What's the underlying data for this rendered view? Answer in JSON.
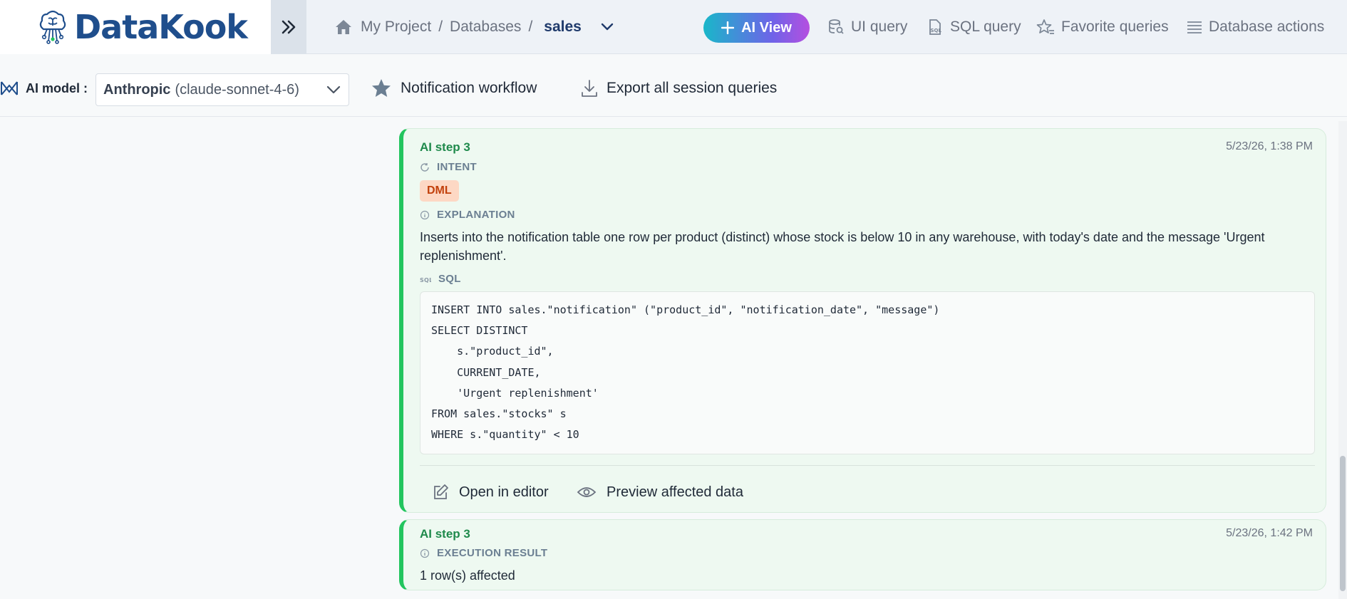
{
  "app": {
    "name": "DataKook"
  },
  "breadcrumb": {
    "project": "My Project",
    "databases": "Databases",
    "separator": "/",
    "current": "sales"
  },
  "header": {
    "ai_view": "AI View",
    "links": [
      "UI query",
      "SQL query",
      "Favorite queries",
      "Database actions"
    ]
  },
  "toolbar": {
    "model_label": "AI model :",
    "model_provider": "Anthropic",
    "model_name": "(claude-sonnet-4-6)",
    "notification_workflow": "Notification workflow",
    "export_queries": "Export all session queries"
  },
  "steps": [
    {
      "title": "AI step 3",
      "timestamp": "5/23/26, 1:38 PM",
      "intent_label": "INTENT",
      "intent_badge": "DML",
      "explanation_label": "EXPLANATION",
      "explanation": "Inserts into the notification table one row per product (distinct) whose stock is below 10 in any warehouse, with today's date and the message 'Urgent replenishment'.",
      "sql_label": "SQL",
      "sql_lines": [
        "INSERT INTO sales.\"notification\" (\"product_id\", \"notification_date\", \"message\")",
        "SELECT DISTINCT",
        "    s.\"product_id\",",
        "    CURRENT_DATE,",
        "    'Urgent replenishment'",
        "FROM sales.\"stocks\" s",
        "WHERE s.\"quantity\" < 10"
      ],
      "open_editor": "Open in editor",
      "preview": "Preview affected data"
    },
    {
      "title": "AI step 3",
      "timestamp": "5/23/26, 1:42 PM",
      "result_label": "EXECUTION RESULT",
      "result": "1 row(s) affected"
    }
  ],
  "colors": {
    "brand": "#1f4e8c",
    "success": "#22c55e",
    "dml_badge_bg": "#fdd8c4",
    "dml_badge_text": "#c2410c"
  },
  "icons": [
    "brain-cloud-logo-icon",
    "double-chevron-right-icon",
    "home-icon",
    "chevron-down-icon",
    "sparkle-icon",
    "database-search-icon",
    "sql-file-icon",
    "star-list-icon",
    "list-icon",
    "ai-model-icon",
    "star-icon",
    "download-icon",
    "refresh-icon",
    "info-icon",
    "sql-icon",
    "edit-icon",
    "eye-icon"
  ]
}
